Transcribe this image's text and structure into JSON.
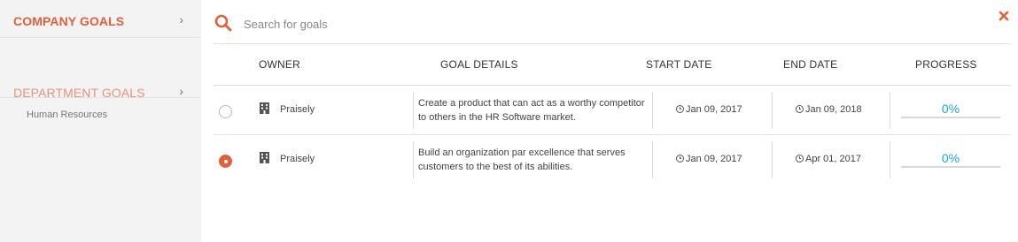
{
  "sidebar": {
    "items": [
      {
        "label": "COMPANY GOALS",
        "chevron": "›"
      },
      {
        "label": "DEPARTMENT GOALS",
        "chevron": "›",
        "sub": "Human Resources"
      }
    ]
  },
  "search": {
    "placeholder": "Search for goals",
    "value": ""
  },
  "table": {
    "headers": [
      "OWNER",
      "GOAL DETAILS",
      "START DATE",
      "END DATE",
      "PROGRESS"
    ],
    "rows": [
      {
        "selected": false,
        "owner": "Praisely",
        "details": "Create a product that can act as a worthy competitor to others in the HR Software market.",
        "start_date": "Jan 09, 2017",
        "end_date": "Jan 09, 2018",
        "progress_label": "0%",
        "progress": 0
      },
      {
        "selected": true,
        "owner": "Praisely",
        "details": "Build an organization par excellence that serves customers to the best of its abilities.",
        "start_date": "Jan 09, 2017",
        "end_date": "Apr 01, 2017",
        "progress_label": "0%",
        "progress": 0
      }
    ]
  },
  "icons": {
    "search": "search-icon",
    "close": "close-icon",
    "owner": "building-icon",
    "date": "clock-icon"
  },
  "colors": {
    "accent": "#e2603a",
    "accent_light": "#e8937a",
    "progress": "#1aa7e0",
    "sidebar_bg": "#f3f3f3"
  }
}
